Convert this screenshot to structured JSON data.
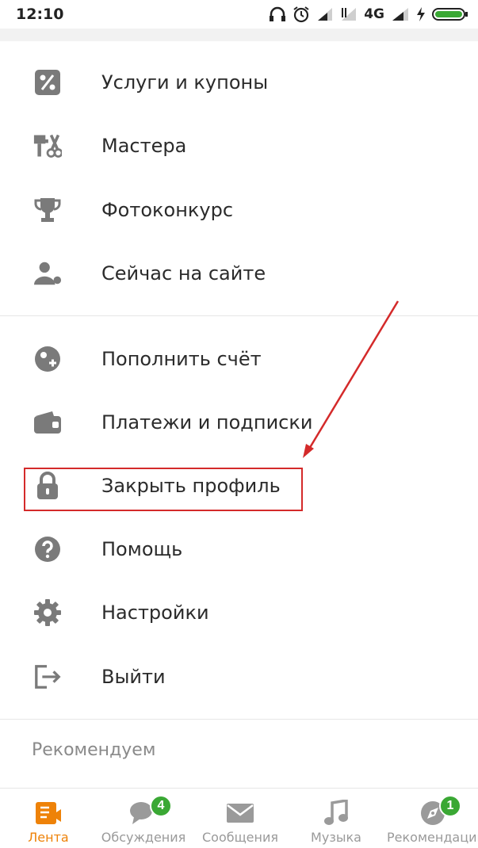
{
  "status_bar": {
    "time": "12:10",
    "network": "4G"
  },
  "menu": {
    "items": [
      {
        "label": "Услуги и купоны",
        "icon": "percent-icon"
      },
      {
        "label": "Мастера",
        "icon": "tools-icon"
      },
      {
        "label": "Фотоконкурс",
        "icon": "trophy-icon"
      },
      {
        "label": "Сейчас на сайте",
        "icon": "user-online-icon"
      },
      {
        "label": "Пополнить счёт",
        "icon": "coin-add-icon"
      },
      {
        "label": "Платежи и подписки",
        "icon": "wallet-icon"
      },
      {
        "label": "Закрыть профиль",
        "icon": "lock-icon"
      },
      {
        "label": "Помощь",
        "icon": "help-icon"
      },
      {
        "label": "Настройки",
        "icon": "gear-icon"
      },
      {
        "label": "Выйти",
        "icon": "logout-icon"
      }
    ],
    "section_header": "Рекомендуем"
  },
  "tabbar": {
    "tabs": [
      {
        "label": "Лента",
        "icon": "feed-icon",
        "active": true
      },
      {
        "label": "Обсуждения",
        "icon": "discussions-icon",
        "badge": "4"
      },
      {
        "label": "Сообщения",
        "icon": "messages-icon"
      },
      {
        "label": "Музыка",
        "icon": "music-icon"
      },
      {
        "label": "Рекомендации",
        "icon": "recommendations-icon",
        "badge": "1"
      }
    ]
  },
  "colors": {
    "accent": "#ee8208",
    "icon_gray": "#7a7a7a",
    "badge_green": "#3aa834",
    "highlight_red": "#d42a2a"
  }
}
